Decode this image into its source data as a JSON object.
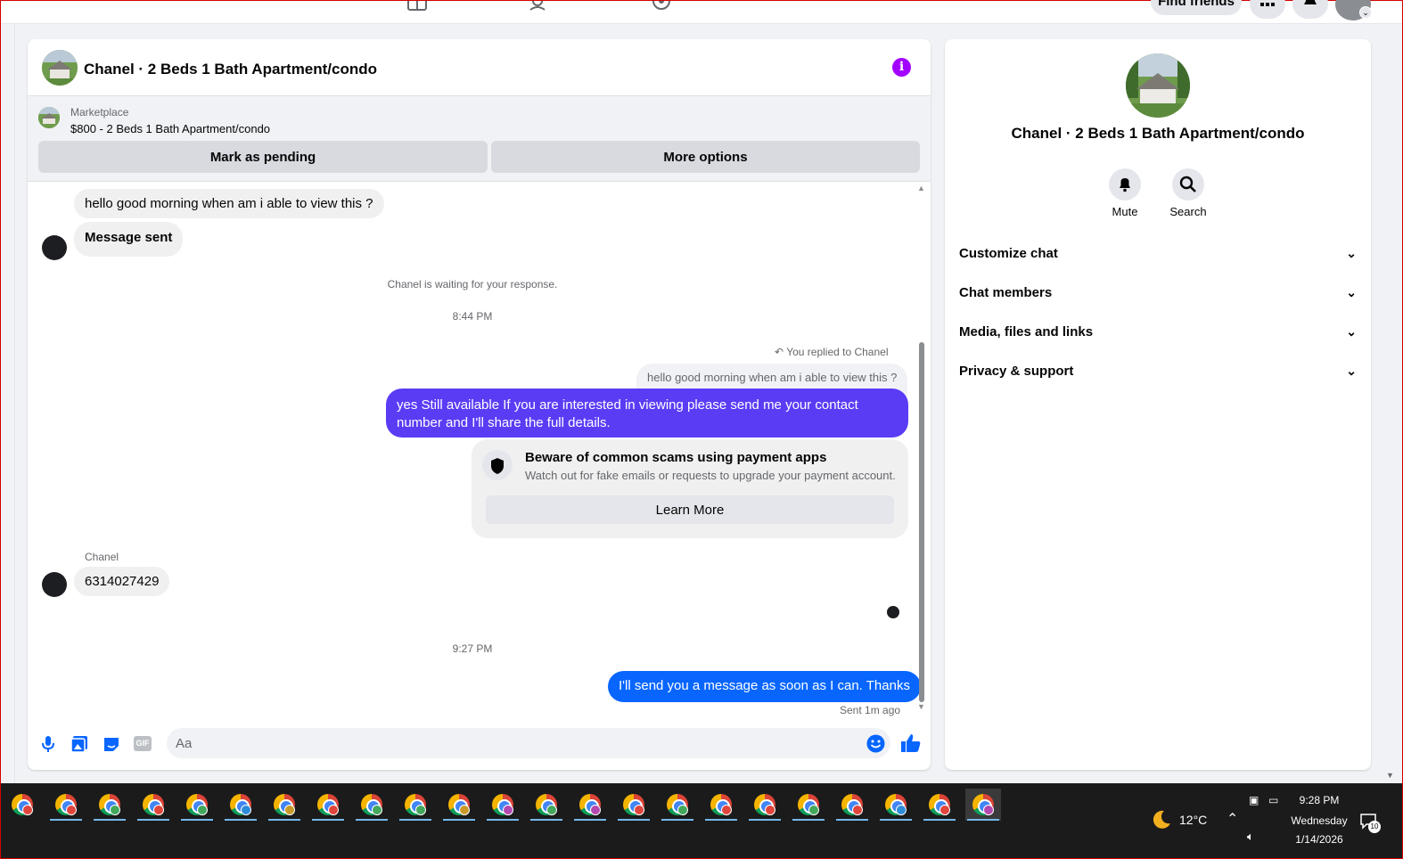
{
  "topnav": {
    "find_friends": "Find friends"
  },
  "chat": {
    "title": "Chanel · 2 Beds 1 Bath Apartment/condo",
    "marketplace_label": "Marketplace",
    "listing": "$800 - 2 Beds 1 Bath Apartment/condo",
    "mark_pending": "Mark as pending",
    "more_options": "More options",
    "messages": {
      "incoming_1": "hello good morning when am i able to view this ?",
      "incoming_2": "Message sent",
      "waiting": "Chanel is waiting for your response.",
      "time_1": "8:44 PM",
      "replied_to": "You replied to Chanel",
      "quoted": "hello good morning when am i able to view this ?",
      "outgoing_1": "yes Still available If you are interested in viewing please send me your contact number and I'll share the full details.",
      "scam_title": "Beware of common scams using payment apps",
      "scam_body": "Watch out for fake emails or requests to upgrade your payment account.",
      "learn_more": "Learn More",
      "sender_name": "Chanel",
      "incoming_3": "6314027429",
      "time_2": "9:27 PM",
      "outgoing_2": "I'll send you a message as soon as I can. Thanks",
      "sent_status": "Sent 1m ago"
    },
    "composer_placeholder": "Aa"
  },
  "details": {
    "title": "Chanel · 2 Beds 1 Bath Apartment/condo",
    "mute": "Mute",
    "search": "Search",
    "sections": [
      "Customize chat",
      "Chat members",
      "Media, files and links",
      "Privacy & support"
    ]
  },
  "taskbar": {
    "app_count": 23,
    "temperature": "12°C",
    "time": "9:28 PM",
    "day": "Wednesday",
    "date": "1/14/2026",
    "notifications": "10"
  },
  "colors": {
    "accent_blue": "#0866ff",
    "reply_purple": "#5b3cf5",
    "info_purple": "#a200ff"
  }
}
